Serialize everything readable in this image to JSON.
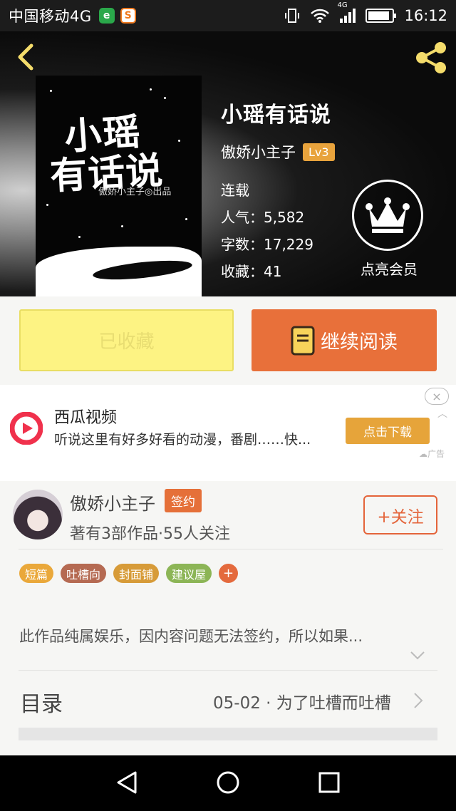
{
  "status_bar": {
    "carrier": "中国移动4G",
    "app1": "e",
    "app2": "S",
    "net_label": "4G",
    "time": "16:12"
  },
  "book": {
    "title": "小瑶有话说",
    "author": "傲娇小主子",
    "level": "Lv3",
    "status": "连载",
    "popularity": "人气：5,582",
    "word_count": "字数：17,229",
    "favorites": "收藏：41",
    "cover": {
      "title_line1": "小瑶",
      "title_line2": "有话说",
      "credit": "傲娇小主子◎出品"
    }
  },
  "vip": {
    "label": "点亮会员"
  },
  "actions": {
    "favorited": "已收藏",
    "continue_reading": "继续阅读"
  },
  "ad": {
    "title": "西瓜视频",
    "desc": "听说这里有好多好看的动漫，番剧……快...",
    "button": "点击下载",
    "close": "×",
    "up": "︿",
    "mark": "广告"
  },
  "author_card": {
    "name": "傲娇小主子",
    "badge": "签约",
    "works": "著有3部作品·55人关注",
    "follow": "+关注"
  },
  "tags": [
    {
      "label": "短篇",
      "color": "#eaa83a"
    },
    {
      "label": "吐槽向",
      "color": "#b56a52"
    },
    {
      "label": "封面铺",
      "color": "#d79b38"
    },
    {
      "label": "建议屋",
      "color": "#8cb556"
    }
  ],
  "tag_add": "+",
  "summary": "此作品纯属娱乐，因内容问题无法签约，所以如果...",
  "toc": {
    "label": "目录",
    "latest": "05-02 · 为了吐槽而吐槽"
  },
  "colors": {
    "accent_orange": "#e8703a",
    "favorite_yellow": "#fdf383",
    "level_badge": "#e8a33c"
  }
}
